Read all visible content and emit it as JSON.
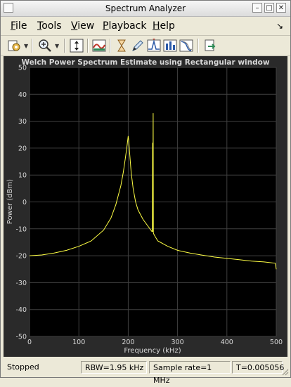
{
  "window": {
    "title": "Spectrum Analyzer",
    "controls": [
      "–",
      "□",
      "✕"
    ]
  },
  "menu": {
    "items": [
      "File",
      "Tools",
      "View",
      "Playback",
      "Help"
    ],
    "underlined": [
      "F",
      "T",
      "V",
      "P",
      "H"
    ],
    "overflow_arrow": "↘"
  },
  "toolbar": {
    "icons": [
      "settings-icon",
      "zoom-in-icon",
      "scale-axes-icon",
      "spectrum-icon",
      "cursor-hourglass-icon",
      "pencil-icon",
      "peak-finder-icon",
      "channel-measurements-icon",
      "distortion-icon",
      "export-icon"
    ]
  },
  "colors": {
    "plot_bg": "#000000",
    "panel_bg": "#2a2a2a",
    "trace": "#ffff44",
    "grid": "#404040",
    "text": "#d8d8d8"
  },
  "chart_data": {
    "type": "line",
    "title": "Welch Power Spectrum Estimate using Rectangular window",
    "xlabel": "Frequency (kHz)",
    "ylabel": "Power (dBm)",
    "xlim": [
      0,
      500
    ],
    "ylim": [
      -50,
      50
    ],
    "xticks": [
      0,
      100,
      200,
      300,
      400,
      500
    ],
    "yticks": [
      -50,
      -40,
      -30,
      -20,
      -10,
      0,
      10,
      20,
      30,
      40,
      50
    ],
    "grid": true,
    "series": [
      {
        "x": [
          0,
          25,
          50,
          75,
          100,
          125,
          150,
          165,
          175,
          185,
          190,
          194,
          197,
          199,
          200,
          201,
          203,
          206,
          210,
          215,
          220,
          230,
          240,
          246,
          248,
          249,
          249.5,
          250,
          250.5,
          251,
          252,
          255,
          260,
          280,
          300,
          325,
          350,
          375,
          400,
          425,
          450,
          475,
          498,
          500
        ],
        "values": [
          -20,
          -19.7,
          -19,
          -18,
          -16.5,
          -14.5,
          -10.5,
          -6,
          -1,
          6,
          11,
          16,
          20,
          23,
          24.5,
          23,
          18,
          11,
          5,
          0,
          -3,
          -6.5,
          -9,
          -10.5,
          -11,
          -11,
          22,
          -11,
          33,
          -11.5,
          -12,
          -13,
          -14.5,
          -16.5,
          -18,
          -19,
          -19.8,
          -20.5,
          -21,
          -21.5,
          -22,
          -22.3,
          -22.8,
          -25
        ]
      }
    ]
  },
  "status": {
    "state": "Stopped",
    "rbw": "RBW=1.95 kHz",
    "sample_rate": "Sample rate=1 MHz",
    "time": "T=0.005056"
  }
}
